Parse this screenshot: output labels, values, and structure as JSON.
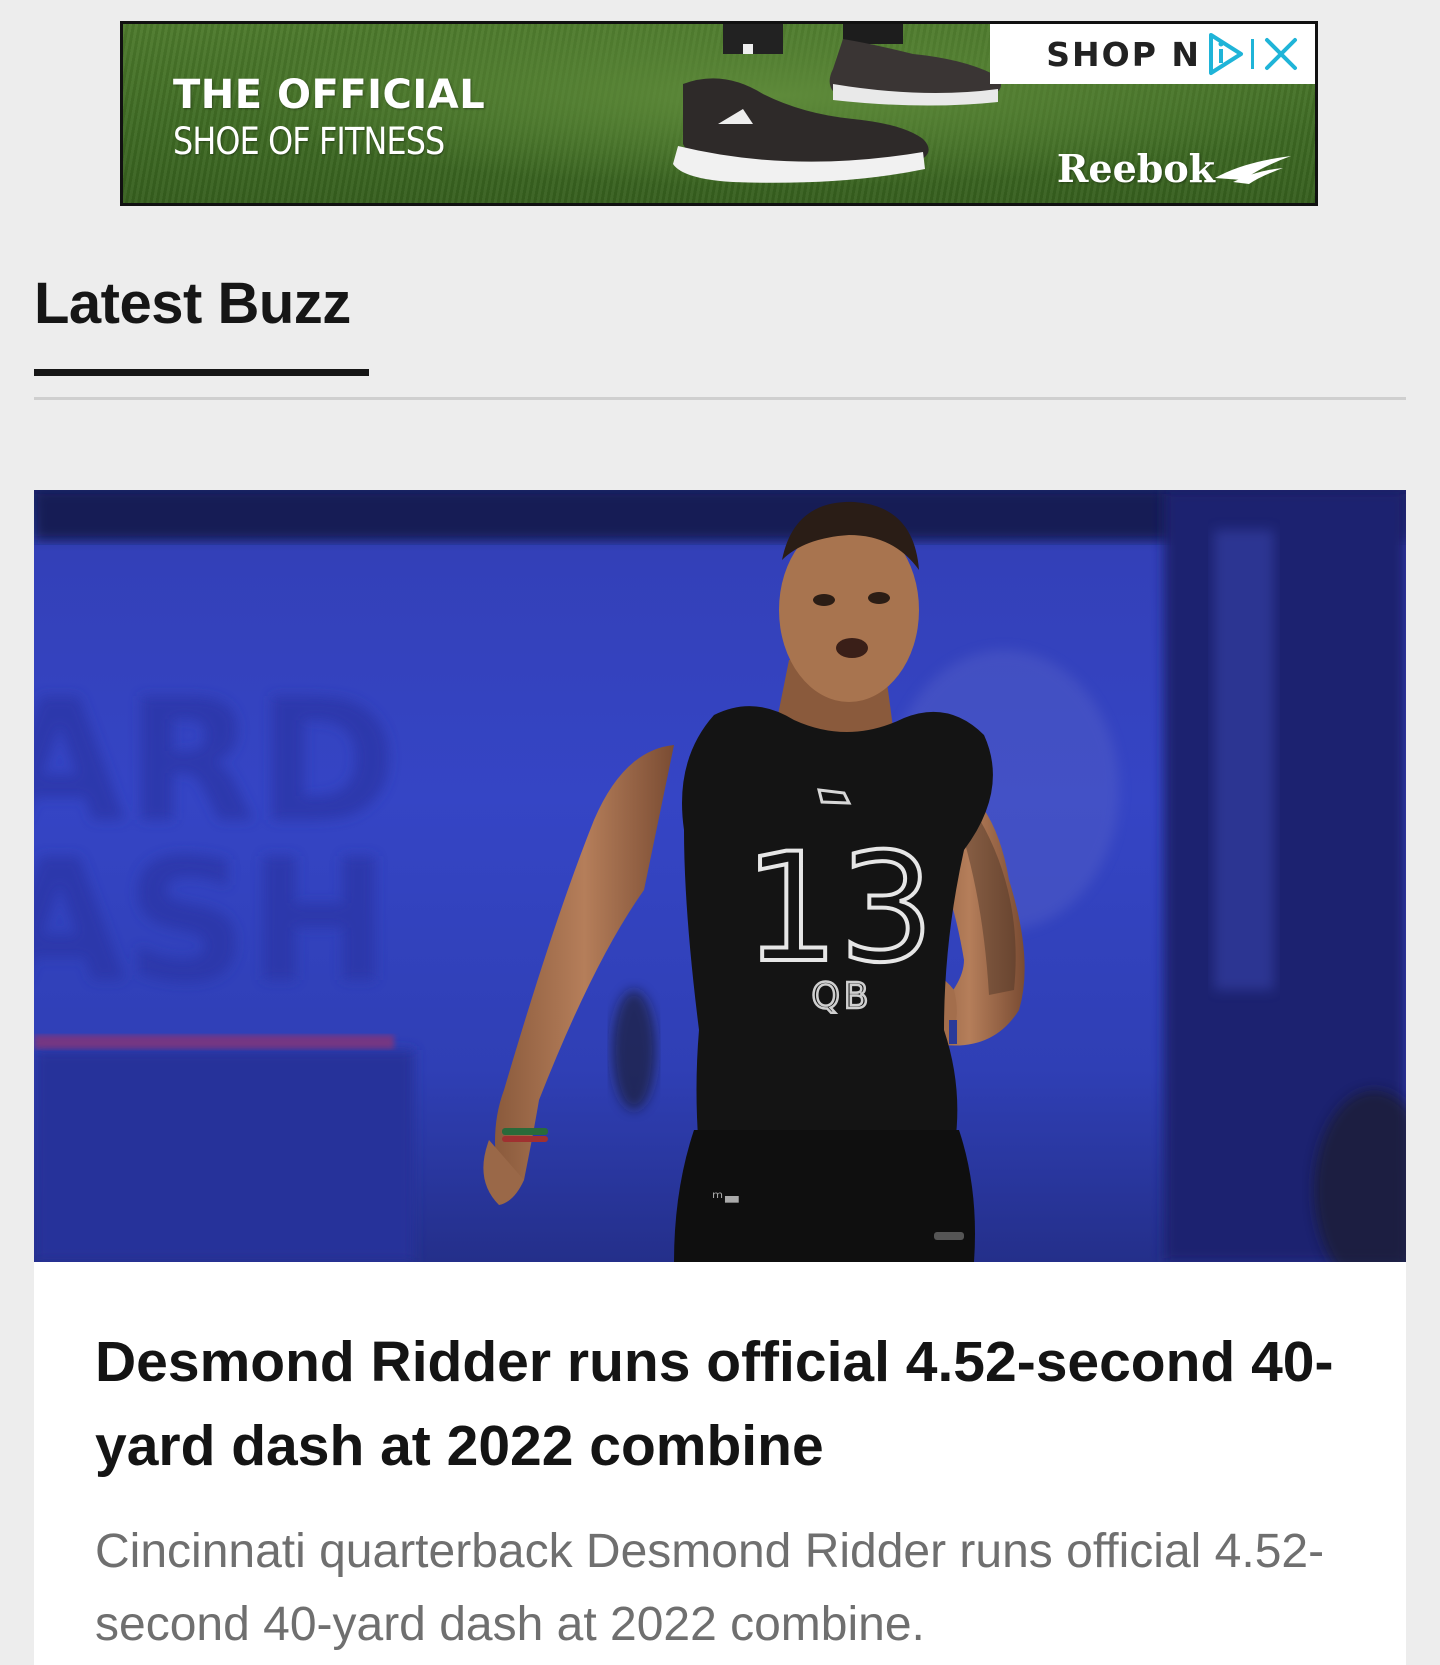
{
  "ad": {
    "headline": "THE OFFICIAL",
    "subline": "SHOE OF FITNESS",
    "shop_label": "SHOP N",
    "brand": "Reebok",
    "adchoices_icon": "adchoices-play-icon",
    "close_icon": "close-icon",
    "colors": {
      "grass": "#4d7a2c",
      "adchoices": "#1fb4d8"
    }
  },
  "section": {
    "title": "Latest Buzz"
  },
  "article": {
    "image_icon": "athlete-photo",
    "jersey_number": "13",
    "jersey_position": "QB",
    "title": "Desmond Ridder runs official 4.52-second 40-yard dash at 2022 combine",
    "summary": "Cincinnati quarterback Desmond Ridder runs official 4.52-second 40-yard dash at 2022 combine."
  }
}
